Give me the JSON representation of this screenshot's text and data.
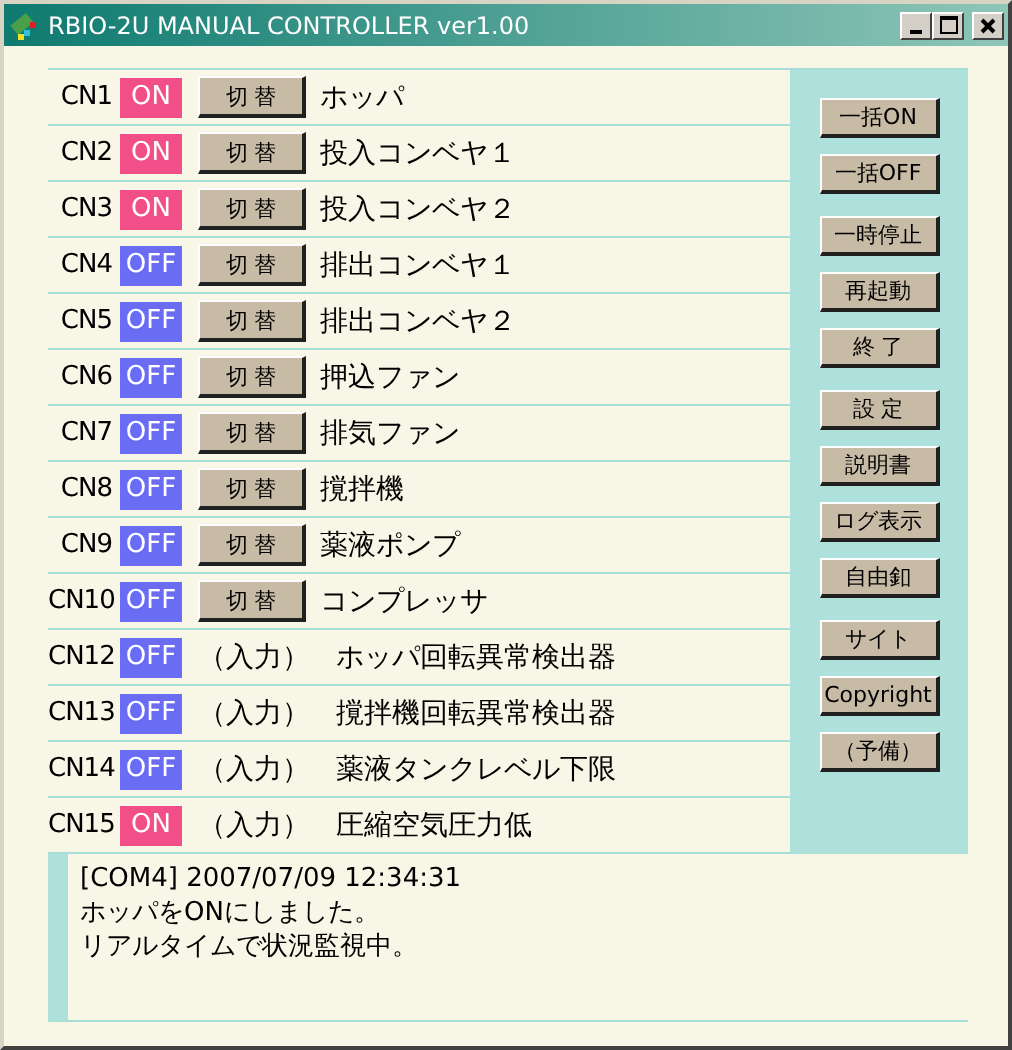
{
  "window": {
    "title": "RBIO-2U MANUAL CONTROLLER ver1.00"
  },
  "channels": [
    {
      "kind": "output",
      "label": "CN1",
      "on": true,
      "state": "ON",
      "button": "切 替",
      "name": "ホッパ"
    },
    {
      "kind": "output",
      "label": "CN2",
      "on": true,
      "state": "ON",
      "button": "切 替",
      "name": "投入コンベヤ１"
    },
    {
      "kind": "output",
      "label": "CN3",
      "on": true,
      "state": "ON",
      "button": "切 替",
      "name": "投入コンベヤ２"
    },
    {
      "kind": "output",
      "label": "CN4",
      "on": false,
      "state": "OFF",
      "button": "切 替",
      "name": "排出コンベヤ１"
    },
    {
      "kind": "output",
      "label": "CN5",
      "on": false,
      "state": "OFF",
      "button": "切 替",
      "name": "排出コンベヤ２"
    },
    {
      "kind": "output",
      "label": "CN6",
      "on": false,
      "state": "OFF",
      "button": "切 替",
      "name": "押込ファン"
    },
    {
      "kind": "output",
      "label": "CN7",
      "on": false,
      "state": "OFF",
      "button": "切 替",
      "name": "排気ファン"
    },
    {
      "kind": "output",
      "label": "CN8",
      "on": false,
      "state": "OFF",
      "button": "切 替",
      "name": "撹拌機"
    },
    {
      "kind": "output",
      "label": "CN9",
      "on": false,
      "state": "OFF",
      "button": "切 替",
      "name": "薬液ポンプ"
    },
    {
      "kind": "output",
      "label": "CN10",
      "on": false,
      "state": "OFF",
      "button": "切 替",
      "name": "コンプレッサ"
    },
    {
      "kind": "input",
      "label": "CN12",
      "on": false,
      "state": "OFF",
      "tag": "（入力）",
      "name": "ホッパ回転異常検出器"
    },
    {
      "kind": "input",
      "label": "CN13",
      "on": false,
      "state": "OFF",
      "tag": "（入力）",
      "name": "撹拌機回転異常検出器"
    },
    {
      "kind": "input",
      "label": "CN14",
      "on": false,
      "state": "OFF",
      "tag": "（入力）",
      "name": "薬液タンクレベル下限"
    },
    {
      "kind": "input",
      "label": "CN15",
      "on": true,
      "state": "ON",
      "tag": "（入力）",
      "name": "圧縮空気圧力低"
    }
  ],
  "side_buttons": [
    [
      "一括ON",
      "一括OFF"
    ],
    [
      "一時停止",
      "再起動",
      "終 了"
    ],
    [
      "設 定",
      "説明書",
      "ログ表示",
      "自由釦"
    ],
    [
      "サイト",
      "Copyright",
      "（予備）"
    ]
  ],
  "log": [
    "[COM4] 2007/07/09 12:34:31",
    "ホッパをONにしました。",
    "リアルタイムで状況監視中。"
  ]
}
